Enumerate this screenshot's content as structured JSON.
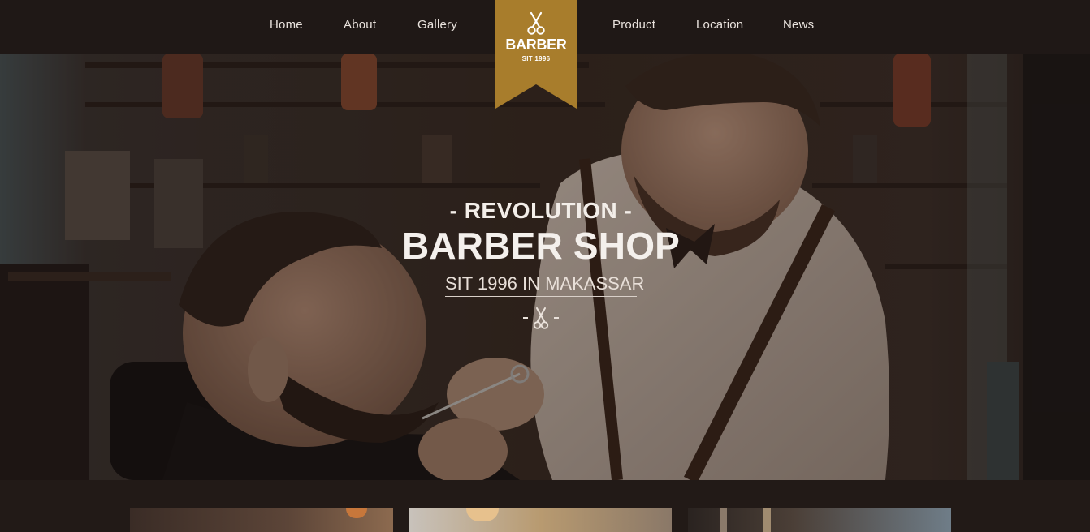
{
  "nav": {
    "home": "Home",
    "about": "About",
    "gallery": "Gallery",
    "product": "Product",
    "location": "Location",
    "news": "News"
  },
  "logo": {
    "title": "BARBER",
    "subtitle": "SIT 1996",
    "icon": "scissors-icon"
  },
  "hero": {
    "kicker": "- REVOLUTION -",
    "title": "BARBER SHOP",
    "subtitle": "SIT 1996 IN MAKASSAR",
    "divider_icon": "scissors-icon"
  },
  "colors": {
    "nav_background": "#1f1816",
    "ribbon": "#a87d2c",
    "page_background": "#221a17",
    "text_light": "#f4f0ec"
  }
}
